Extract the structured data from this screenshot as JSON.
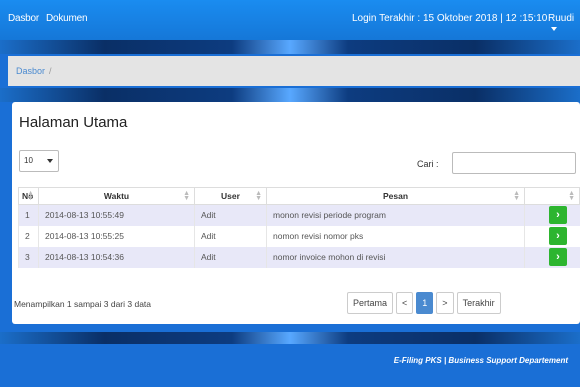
{
  "nav": {
    "links": [
      "Dasbor",
      "Dokumen"
    ],
    "last_login": "Login Terakhir : 15 Oktober 2018 | 12 :15:10",
    "user": "Ruudi"
  },
  "breadcrumb": {
    "crumb": "Dasbor",
    "separator": "/"
  },
  "page": {
    "title": "Halaman Utama"
  },
  "length_select": {
    "value": "10"
  },
  "search": {
    "label": "Cari :",
    "value": ""
  },
  "table": {
    "columns": [
      "No",
      "Waktu",
      "User",
      "Pesan",
      ""
    ],
    "rows": [
      {
        "no": "1",
        "waktu": "2014-08-13 10:55:49",
        "user": "Adit",
        "pesan": "monon revisi periode program"
      },
      {
        "no": "2",
        "waktu": "2014-08-13 10:55:25",
        "user": "Adit",
        "pesan": "nomon revisi nomor pks"
      },
      {
        "no": "3",
        "waktu": "2014-08-13 10:54:36",
        "user": "Adit",
        "pesan": "nomor invoice mohon di revisi"
      }
    ],
    "action_icon": "chevron-right-icon"
  },
  "info": "Menampilkan 1 sampai 3 dari 3 data",
  "pager": {
    "first": "Pertama",
    "prev": "<",
    "current": "1",
    "next": ">",
    "last": "Terakhir"
  },
  "footer": "E-Filing PKS | Business Support Departement",
  "colors": {
    "navbar": "#1a8cf0",
    "accent": "#4a8ad0",
    "action": "#2db52f",
    "row_odd": "#e8e8f8"
  }
}
